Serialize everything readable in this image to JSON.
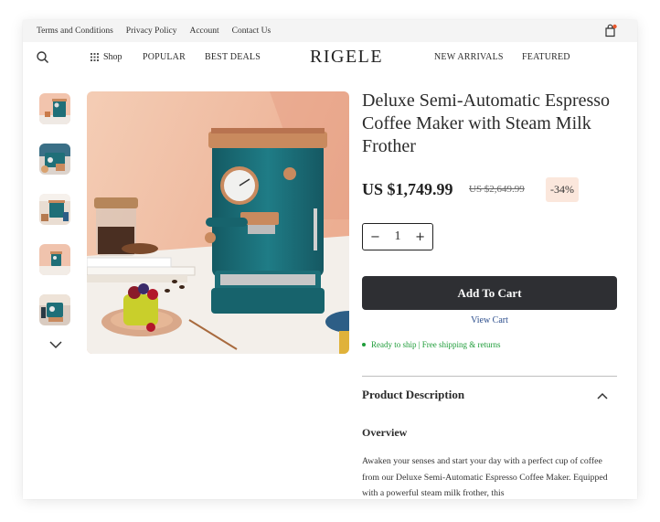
{
  "topbar": {
    "links": [
      "Terms and Conditions",
      "Privacy Policy",
      "Account",
      "Contact Us"
    ]
  },
  "nav": {
    "shop_label": "Shop",
    "popular_label": "POPULAR",
    "deals_label": "BEST DEALS",
    "logo": "RIGELE",
    "arrivals_label": "NEW ARRIVALS",
    "featured_label": "FEATURED"
  },
  "product": {
    "title": "Deluxe Semi-Automatic Espresso Coffee Maker with Steam Milk Frother",
    "price": "US $1,749.99",
    "old_price": "US $2,649.99",
    "discount": "-34%",
    "quantity": "1",
    "add_to_cart": "Add To Cart",
    "view_cart": "View Cart",
    "shipping": "Ready to ship | Free shipping & returns"
  },
  "description": {
    "heading": "Product Description",
    "overview": "Overview",
    "text": "Awaken your senses and start your day with a perfect cup of coffee from our Deluxe Semi-Automatic Espresso Coffee Maker. Equipped with a powerful steam milk frother, this"
  },
  "icons": {
    "search": "search-icon",
    "grid": "grid-icon",
    "bag": "shopping-bag-icon",
    "chevron_down": "chevron-down-icon",
    "chevron_up": "chevron-up-icon"
  },
  "colors": {
    "accent_button": "#2e2f33",
    "discount_bg": "#fbe7dc",
    "shipping_green": "#1f9d3a",
    "link_blue": "#2b4d8c",
    "machine_teal": "#1f6f78",
    "copper": "#c98a5e"
  }
}
